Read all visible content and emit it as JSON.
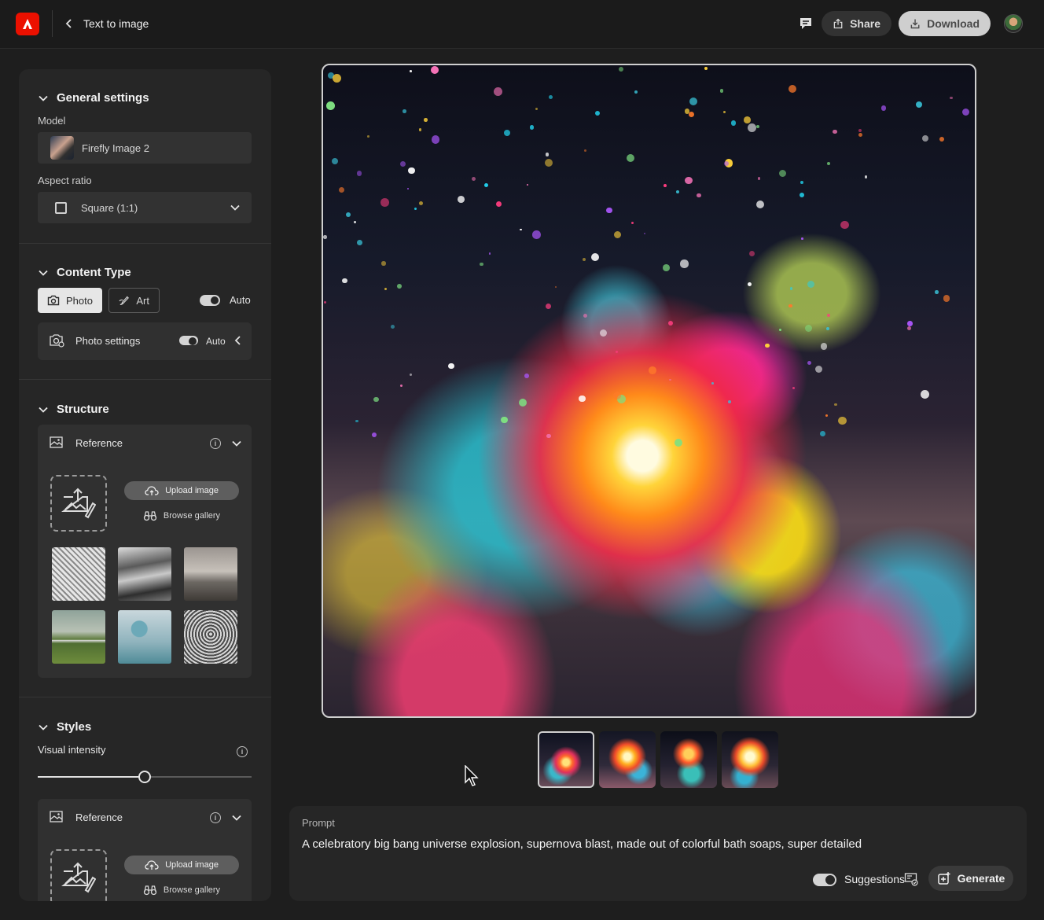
{
  "header": {
    "breadcrumb": "Text to image",
    "share_label": "Share",
    "download_label": "Download"
  },
  "general_settings": {
    "title": "General settings",
    "model_label": "Model",
    "model_value": "Firefly Image 2",
    "aspect_label": "Aspect ratio",
    "aspect_value": "Square (1:1)"
  },
  "content_type": {
    "title": "Content Type",
    "photo_label": "Photo",
    "art_label": "Art",
    "auto_label": "Auto",
    "photo_settings_label": "Photo settings",
    "photo_settings_auto": "Auto"
  },
  "structure": {
    "title": "Structure",
    "reference_label": "Reference",
    "upload_label": "Upload image",
    "browse_label": "Browse gallery"
  },
  "styles": {
    "title": "Styles",
    "visual_intensity_label": "Visual intensity",
    "visual_intensity_fraction": 0.5,
    "reference_label": "Reference",
    "upload_label": "Upload image",
    "browse_label": "Browse gallery"
  },
  "prompt": {
    "label": "Prompt",
    "text": "A celebratory big bang universe explosion, supernova blast, made out of colorful bath soaps, super detailed",
    "suggestions_label": "Suggestions",
    "generate_label": "Generate"
  },
  "colors": {
    "background": "#1e1e1e",
    "panel": "#262626",
    "brand": "#eb1000"
  }
}
